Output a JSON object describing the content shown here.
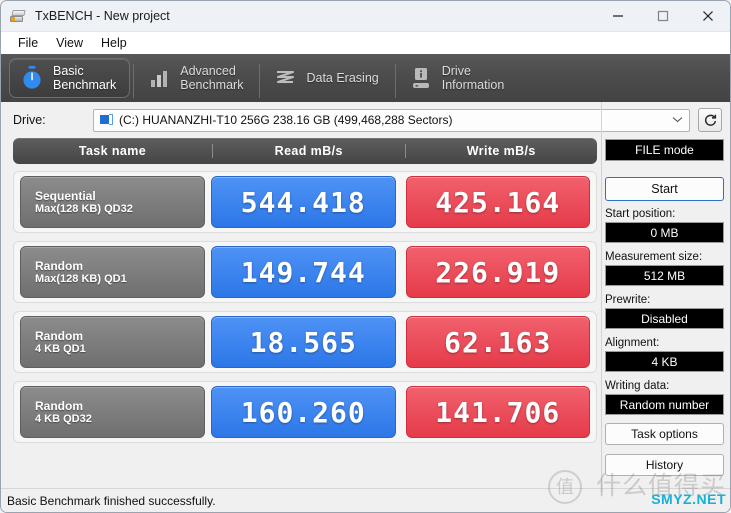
{
  "window": {
    "title": "TxBENCH - New project",
    "app_icon": "drive-icon",
    "controls": {
      "minimize": "minimize-icon",
      "maximize": "maximize-icon",
      "close": "close-icon"
    }
  },
  "menubar": {
    "items": [
      {
        "label": "File"
      },
      {
        "label": "View"
      },
      {
        "label": "Help"
      }
    ]
  },
  "tabs": [
    {
      "label": "Basic\nBenchmark",
      "icon": "stopwatch-icon",
      "active": true
    },
    {
      "label": "Advanced\nBenchmark",
      "icon": "bar-chart-icon",
      "active": false
    },
    {
      "label": "Data Erasing",
      "icon": "shred-icon",
      "active": false
    },
    {
      "label": "Drive\nInformation",
      "icon": "drive-info-icon",
      "active": false
    }
  ],
  "drive": {
    "label": "Drive:",
    "value": "(C:) HUANANZHI-T10 256G  238.16 GB (499,468,288 Sectors)",
    "dropdown_icon": "chevron-down-icon",
    "refresh_icon": "refresh-icon"
  },
  "table": {
    "headers": {
      "name": "Task name",
      "read": "Read mB/s",
      "write": "Write mB/s"
    },
    "rows": [
      {
        "task_line1": "Sequential",
        "task_line2": "Max(128 KB) QD32",
        "read": "544.418",
        "write": "425.164"
      },
      {
        "task_line1": "Random",
        "task_line2": "Max(128 KB) QD1",
        "read": "149.744",
        "write": "226.919"
      },
      {
        "task_line1": "Random",
        "task_line2": "4 KB QD1",
        "read": "18.565",
        "write": "62.163"
      },
      {
        "task_line1": "Random",
        "task_line2": "4 KB QD32",
        "read": "160.260",
        "write": "141.706"
      }
    ]
  },
  "sidebar": {
    "mode_button": "FILE mode",
    "start_button": "Start",
    "fields": [
      {
        "label": "Start position:",
        "value": "0 MB"
      },
      {
        "label": "Measurement size:",
        "value": "512 MB"
      },
      {
        "label": "Prewrite:",
        "value": "Disabled"
      },
      {
        "label": "Alignment:",
        "value": "4 KB"
      },
      {
        "label": "Writing data:",
        "value": "Random number"
      }
    ],
    "task_options_button": "Task options",
    "history_button": "History"
  },
  "statusbar": {
    "text": "Basic Benchmark finished successfully."
  },
  "watermark": {
    "cn": "什么值得买",
    "en": "SMYZ.NET",
    "mark": "值"
  },
  "colors": {
    "read_accent": "#3a86f0",
    "write_accent": "#e8434f",
    "tab_bar": "#4c4c4c",
    "start_border": "#2b72c4"
  }
}
